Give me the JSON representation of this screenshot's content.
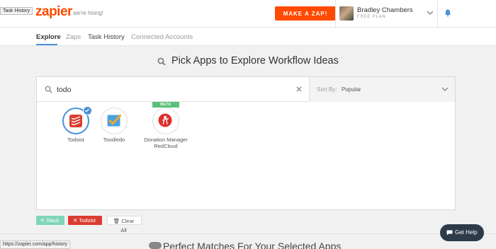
{
  "tooltip": "Task History",
  "header": {
    "logo": "zapier",
    "hiring": "we're hiring!",
    "make_zap": "MAKE A ZAP!",
    "user_name": "Bradley Chambers",
    "user_plan": "FREE PLAN"
  },
  "tabs": [
    {
      "label": "Explore"
    },
    {
      "label": "Zaps"
    },
    {
      "label": "Task History"
    },
    {
      "label": "Connected Accounts"
    }
  ],
  "heading": "Pick Apps to Explore Workflow Ideas",
  "search": {
    "value": "todo"
  },
  "sort": {
    "label": "Sort By:",
    "value": "Popular"
  },
  "apps": [
    {
      "name": "Todoist",
      "selected": true
    },
    {
      "name": "Toodledo",
      "selected": false
    },
    {
      "name": "Donation Manager RedCloud",
      "badge": "BETA",
      "selected": false
    }
  ],
  "chips": {
    "slack": "Slack",
    "todoist": "Todoist",
    "clear_all": "Clear All"
  },
  "status_url": "https://zapier.com/app/history",
  "bottom_heading": "Perfect Matches For Your Selected Apps",
  "help": "Get Help",
  "colors": {
    "brand": "#ff4a00",
    "accent": "#4a90d9",
    "todoist": "#db3c30",
    "slack": "#7fd6b7"
  }
}
